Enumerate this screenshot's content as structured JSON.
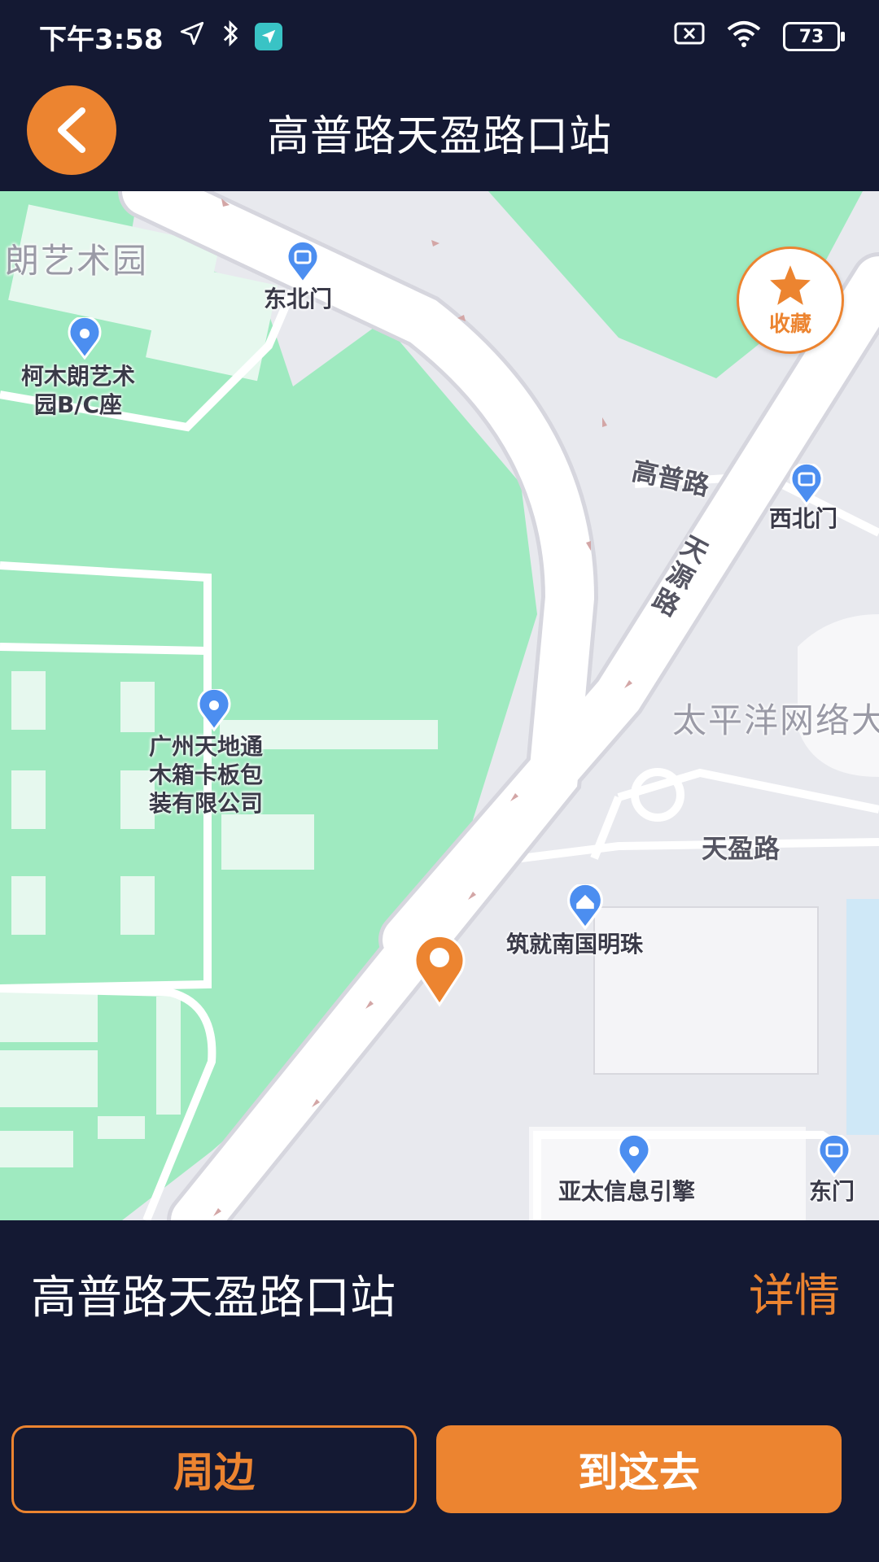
{
  "status_bar": {
    "time": "下午3:58",
    "battery": "73"
  },
  "header": {
    "title": "高普路天盈路口站"
  },
  "map": {
    "favorite_label": "收藏",
    "labels": {
      "park_partial": "朗艺术园",
      "northeast_gate": "东北门",
      "kemulang_building": "柯木朗艺术\n园B/C座",
      "gaopu_road": "高普路",
      "northwest_gate": "西北门",
      "tianyuan_road": "天源路",
      "pacific_partial": "太平洋网络大",
      "tiandi_company": "广州天地通\n木箱卡板包\n装有限公司",
      "tianying_road": "天盈路",
      "zhujiu_mingzhu": "筑就南国明珠",
      "yatai_engine": "亚太信息引擎",
      "east_gate": "东门"
    },
    "colors": {
      "green": "#9feac0",
      "road": "#ffffff",
      "ground": "#e8e9ee",
      "pin_orange": "#ec8430",
      "poi_blue": "#4c8ef0"
    }
  },
  "panel": {
    "station_name": "高普路天盈路口站",
    "detail_label": "详情",
    "nearby_label": "周边",
    "go_label": "到这去"
  },
  "colors": {
    "background": "#141933",
    "accent": "#ec8430"
  }
}
